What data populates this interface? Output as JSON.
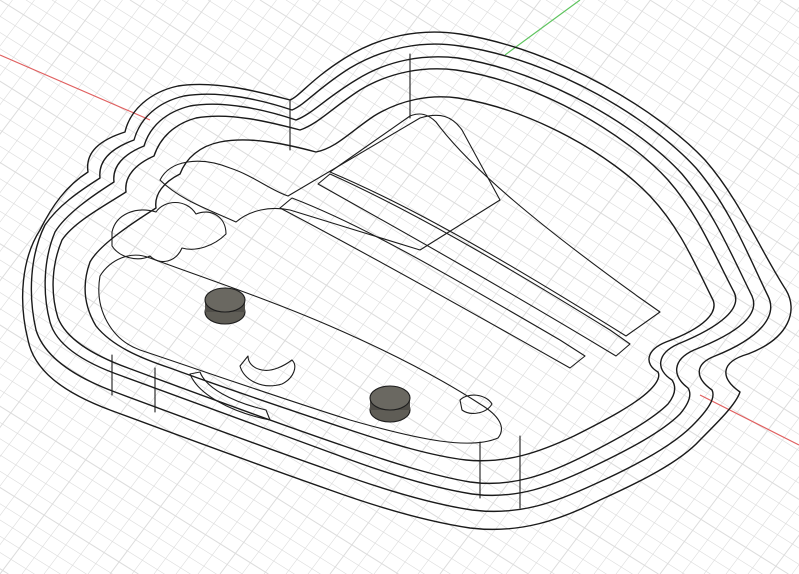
{
  "viewport": {
    "background": "#ffffff",
    "grid_color": "#dcdcdc",
    "axis_x_color": "#e06060",
    "axis_y_color": "#5fc45f"
  },
  "model": {
    "body_color": "#5a5852",
    "wall_top_color": "#6e6b63",
    "floor_color": "#56544e",
    "edge_color": "#1d1d1d"
  }
}
